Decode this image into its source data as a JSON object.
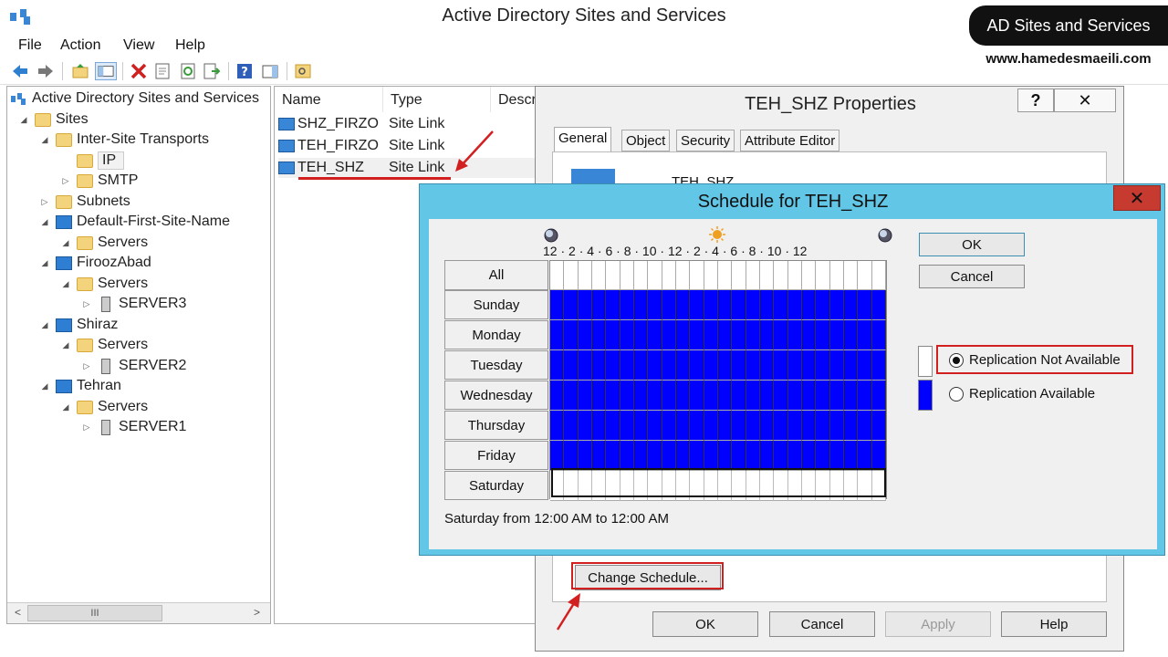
{
  "window": {
    "title": "Active Directory Sites and Services"
  },
  "menu": [
    "File",
    "Action",
    "View",
    "Help"
  ],
  "tree": {
    "root": "Active Directory Sites and Services",
    "nodes": [
      {
        "label": "Sites"
      },
      {
        "label": "Inter-Site Transports"
      },
      {
        "label": "IP"
      },
      {
        "label": "SMTP"
      },
      {
        "label": "Subnets"
      },
      {
        "label": "Default-First-Site-Name"
      },
      {
        "label": "Servers"
      },
      {
        "label": "FiroozAbad"
      },
      {
        "label": "Servers"
      },
      {
        "label": "SERVER3"
      },
      {
        "label": "Shiraz"
      },
      {
        "label": "Servers"
      },
      {
        "label": "SERVER2"
      },
      {
        "label": "Tehran"
      },
      {
        "label": "Servers"
      },
      {
        "label": "SERVER1"
      }
    ],
    "scroll_thumb": "III"
  },
  "list": {
    "columns": [
      "Name",
      "Type",
      "Descr"
    ],
    "rows": [
      {
        "name": "SHZ_FIRZO",
        "type": "Site Link"
      },
      {
        "name": "TEH_FIRZO",
        "type": "Site Link"
      },
      {
        "name": "TEH_SHZ",
        "type": "Site Link"
      }
    ]
  },
  "properties": {
    "title": "TEH_SHZ Properties",
    "help_glyph": "?",
    "close_glyph": "✕",
    "tabs": [
      "General",
      "Object",
      "Security",
      "Attribute Editor"
    ],
    "object_name": "TEH_SHZ",
    "change_schedule_label": "Change Schedule...",
    "buttons": {
      "ok": "OK",
      "cancel": "Cancel",
      "apply": "Apply",
      "help": "Help"
    }
  },
  "schedule": {
    "title": "Schedule for TEH_SHZ",
    "close_glyph": "✕",
    "hour_labels": "12 · 2 · 4 · 6 · 8 · 10 · 12 · 2 · 4 · 6 · 8 · 10 · 12",
    "all_label": "All",
    "days": [
      {
        "name": "Sunday",
        "available": true
      },
      {
        "name": "Monday",
        "available": true
      },
      {
        "name": "Tuesday",
        "available": true
      },
      {
        "name": "Wednesday",
        "available": true
      },
      {
        "name": "Thursday",
        "available": true
      },
      {
        "name": "Friday",
        "available": true
      },
      {
        "name": "Saturday",
        "available": false
      }
    ],
    "status": "Saturday from 12:00 AM to 12:00 AM",
    "ok_label": "OK",
    "cancel_label": "Cancel",
    "legend": {
      "not_available": "Replication Not Available",
      "available": "Replication Available",
      "selected": "not_available"
    },
    "colors": {
      "available": "#0000ff",
      "not_available": "#ffffff"
    }
  },
  "watermark": {
    "banner": "AD Sites and Services",
    "url": "www.hamedesmaeili.com"
  },
  "colors": {
    "dialog_frame": "#62c6e6",
    "annotation": "#d21f1f"
  }
}
